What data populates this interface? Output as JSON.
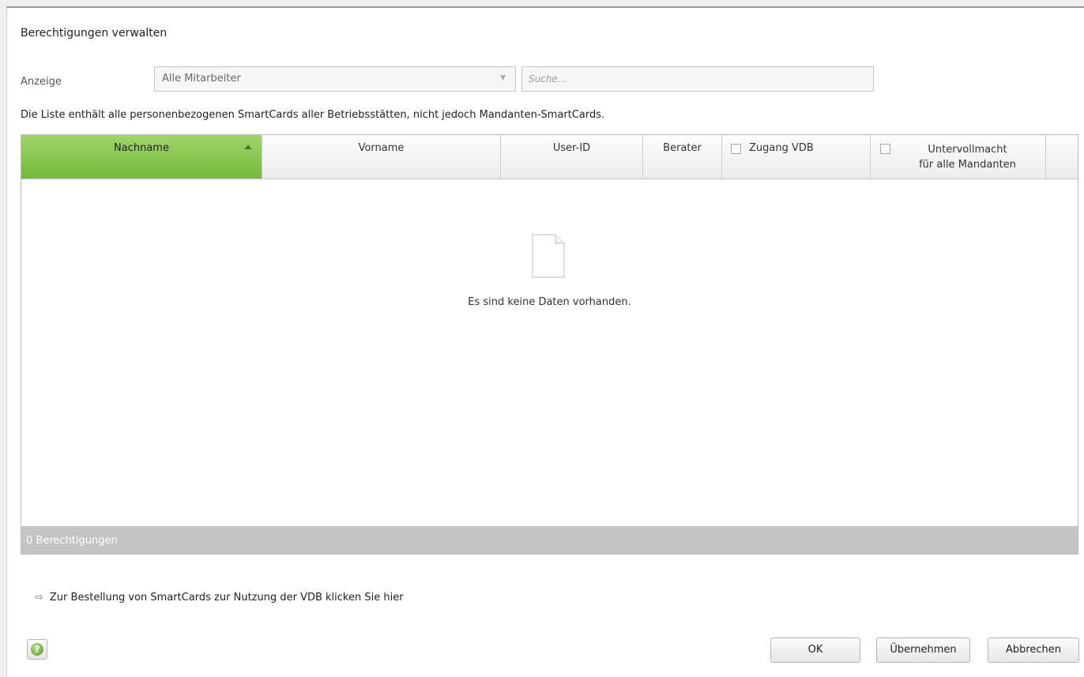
{
  "dialog": {
    "title": "Berechtigungen verwalten"
  },
  "filter": {
    "anzeige_label": "Anzeige",
    "select_value": "Alle Mitarbeiter",
    "search_placeholder": "Suche..."
  },
  "info_text": "Die Liste enthält alle personenbezogenen SmartCards aller Betriebsstätten, nicht jedoch Mandanten-SmartCards.",
  "table": {
    "columns": [
      {
        "label": "Nachname",
        "sorted": "ascending"
      },
      {
        "label": "Vorname"
      },
      {
        "label": "User-ID"
      },
      {
        "label": "Berater"
      },
      {
        "label": "Zugang VDB",
        "checkbox": false
      },
      {
        "label_line1": "Untervollmacht",
        "label_line2": "für alle Mandanten",
        "checkbox": false
      }
    ],
    "rows": [],
    "empty_message": "Es sind keine Daten vorhanden.",
    "footer": "0 Berechtigungen"
  },
  "link_text": "Zur Bestellung von SmartCards zur Nutzung der VDB klicken Sie hier",
  "link_icon": "arrow-right-icon",
  "buttons": {
    "help_icon": "help-icon",
    "ok": "OK",
    "apply": "Übernehmen",
    "cancel": "Abbrechen"
  },
  "colors": {
    "sorted_header": "#86c34c",
    "footer_bar": "#c4c4c4"
  }
}
